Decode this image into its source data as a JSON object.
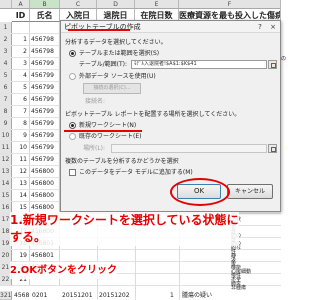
{
  "sheet": {
    "columns": [
      "A",
      "B",
      "C",
      "D",
      "E",
      "F"
    ],
    "headers": [
      "ID",
      "氏名",
      "入院日",
      "退院日",
      "在院日数",
      "医療資源を最も投入した傷病名"
    ],
    "row_numbers": [
      "1",
      "2",
      "3",
      "4",
      "5",
      "6",
      "7",
      "8",
      "9",
      "10",
      "11",
      "12",
      "13",
      "14",
      "15",
      "16",
      "17",
      "18",
      "19",
      "20",
      "21",
      "22"
    ],
    "ids": [
      "",
      "1",
      "2",
      "3",
      "4",
      "5",
      "6",
      "7",
      "8",
      "9",
      "10",
      "11",
      "12",
      "13",
      "14",
      "15",
      "16",
      "17",
      "18",
      "19",
      "20",
      "21"
    ],
    "names": [
      "",
      "456798",
      "456798",
      "456799",
      "456799",
      "456799",
      "456799",
      "456799",
      "456799",
      "456799",
      "456799",
      "456799",
      "456800",
      "456800",
      "456800",
      "456800",
      "456800",
      "456800",
      "456801",
      "456801",
      "456802",
      ""
    ],
    "right_col_text": [
      "ス",
      "乏",
      "的の",
      "梗",
      "性",
      "急",
      "ハ",
      "性",
      "性",
      "状",
      "炎",
      "治",
      "ス",
      "炎",
      "ス"
    ],
    "lower_right_text": [
      "の",
      "の状",
      "肥",
      "を",
      "症",
      "的の",
      "症",
      "的の",
      "的な",
      "性",
      "静",
      "汲",
      "後",
      "機能",
      "心房細動",
      "慢性",
      "不全",
      "肺炎",
      "非腫瘍",
      "低補肝機能障害"
    ],
    "last_row": {
      "row": "321",
      "id": "4568",
      "name": "0201",
      "admit": "20151201",
      "discharge": "20151202",
      "days": "1",
      "diag": "腫瘍の疑い"
    }
  },
  "dialog": {
    "title": "ピボットテーブルの作成",
    "section1": "分析するデータを選択してください。",
    "radio_table": "テーブルまたは範囲を選択(S)",
    "range_label": "テーブル/範囲(T):",
    "range_value": "ﾓﾃﾞﾙ入退院者!$A$1:$K$41",
    "radio_external": "外部データ ソースを使用(U)",
    "choose_connection": "接続の選択(C)...",
    "connection_name": "接続名:",
    "section2": "ピボットテーブル レポートを配置する場所を選択してください。",
    "radio_new_sheet": "新規ワークシート(N)",
    "radio_existing": "既存のワークシート(E)",
    "location_label": "場所(L):",
    "section3": "複数のテーブルを分析するかどうかを選択",
    "add_to_model": "このデータをデータ モデルに追加する(M)",
    "ok": "OK",
    "cancel": "キャンセル",
    "help_icon": "?",
    "close_icon": "×"
  },
  "annotations": {
    "note1_line1": "1.新規ワークシートを選択している状態に",
    "note1_line2": "する。",
    "note2": "2.OKボタンをクリック",
    "color": "#e60000"
  }
}
